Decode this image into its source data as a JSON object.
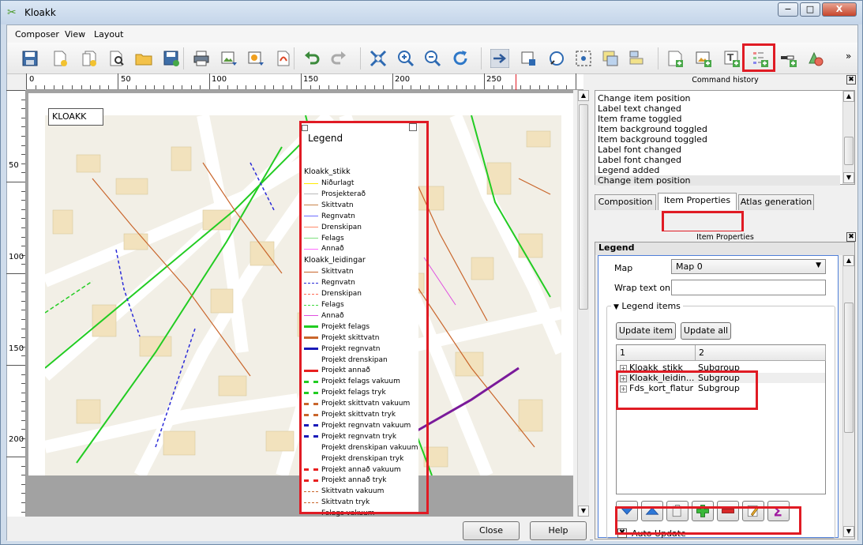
{
  "window": {
    "title": "Kloakk",
    "minimize": "−",
    "maximize": "□",
    "close": "X"
  },
  "menu": [
    "Composer",
    "View",
    "Layout"
  ],
  "toolbar": {
    "icons": [
      "save-icon",
      "new-composer-icon",
      "duplicate-composer-icon",
      "composer-manager-icon",
      "open-folder-icon",
      "save-template-icon",
      "print-icon",
      "export-image-icon",
      "export-svg-icon",
      "export-pdf-icon",
      "undo-icon",
      "redo-icon",
      "zoom-full-icon",
      "zoom-in-icon",
      "zoom-out-icon",
      "refresh-icon",
      "pan-icon",
      "move-content-icon",
      "select-icon",
      "select-group-icon",
      "raise-items-icon",
      "align-items-icon",
      "add-map-icon",
      "add-image-icon",
      "add-label-icon",
      "add-legend-icon",
      "add-scalebar-icon",
      "add-shape-icon"
    ],
    "overflow": "»"
  },
  "ruler": {
    "h_labels": [
      "0",
      "50",
      "100",
      "150",
      "200",
      "250"
    ],
    "v_labels": [
      "50",
      "100",
      "150",
      "200"
    ]
  },
  "canvas": {
    "map_label": "KLOAKK",
    "legend": {
      "title": "Legend",
      "items": [
        {
          "text": "Kloakk_stikk",
          "group": true
        },
        {
          "text": "Niðurlagt",
          "color": "#ffea00",
          "style": "solid",
          "width": 1
        },
        {
          "text": "Prosjekterað",
          "color": "#b9b9b9",
          "style": "solid",
          "width": 1
        },
        {
          "text": "Skittvatn",
          "color": "#c9834a",
          "style": "solid",
          "width": 1
        },
        {
          "text": "Regnvatn",
          "color": "#6d6dff",
          "style": "solid",
          "width": 1
        },
        {
          "text": "Drenskipan",
          "color": "#ff8a6a",
          "style": "solid",
          "width": 1
        },
        {
          "text": "Felags",
          "color": "#7ee07e",
          "style": "solid",
          "width": 1
        },
        {
          "text": "Annað",
          "color": "#ff6eff",
          "style": "solid",
          "width": 1
        },
        {
          "text": "Kloakk_leidingar",
          "group": true
        },
        {
          "text": "Skittvatn",
          "color": "#c9662c",
          "style": "solid",
          "width": 1.5
        },
        {
          "text": "Regnvatn",
          "color": "#2a2ad8",
          "style": "dashed",
          "width": 1.5
        },
        {
          "text": "Drenskipan",
          "color": "#ff6a55",
          "style": "dashed",
          "width": 1.5
        },
        {
          "text": "Felags",
          "color": "#3ed83e",
          "style": "dashed",
          "width": 1.5
        },
        {
          "text": "Annað",
          "color": "#e050e0",
          "style": "solid",
          "width": 1
        },
        {
          "text": "Projekt felags",
          "color": "#22cc22",
          "style": "solid",
          "width": 3
        },
        {
          "text": "Projekt skittvatn",
          "color": "#c9662c",
          "style": "solid",
          "width": 3
        },
        {
          "text": "Projekt regnvatn",
          "color": "#1a1ab8",
          "style": "solid",
          "width": 3
        },
        {
          "text": "Projekt drenskipan",
          "color": "#ffffff",
          "style": "solid",
          "width": 0
        },
        {
          "text": "Projekt annað",
          "color": "#e82020",
          "style": "solid",
          "width": 3
        },
        {
          "text": "Projekt felags vakuum",
          "color": "#22cc22",
          "style": "dashed",
          "width": 3
        },
        {
          "text": "Projekt felags tryk",
          "color": "#22cc22",
          "style": "dashed",
          "width": 3
        },
        {
          "text": "Projekt skittvatn vakuum",
          "color": "#c9662c",
          "style": "dashed",
          "width": 3
        },
        {
          "text": "Projekt skittvatn tryk",
          "color": "#c9662c",
          "style": "dashed",
          "width": 3
        },
        {
          "text": "Projekt regnvatn vakuum",
          "color": "#1a1ab8",
          "style": "dashed",
          "width": 3
        },
        {
          "text": "Projekt regnvatn tryk",
          "color": "#1a1ab8",
          "style": "dashed",
          "width": 3
        },
        {
          "text": "Projekt drenskipan vakuum",
          "color": "#ffffff",
          "style": "solid",
          "width": 0
        },
        {
          "text": "Projekt drenskipan tryk",
          "color": "#ffffff",
          "style": "solid",
          "width": 0
        },
        {
          "text": "Projekt annað vakuum",
          "color": "#e82020",
          "style": "dashed",
          "width": 3
        },
        {
          "text": "Projekt annað tryk",
          "color": "#e82020",
          "style": "dashed",
          "width": 3
        },
        {
          "text": "Skittvatn vakuum",
          "color": "#c9662c",
          "style": "dashed",
          "width": 1
        },
        {
          "text": "Skittvatn tryk",
          "color": "#c9662c",
          "style": "dashed",
          "width": 1
        },
        {
          "text": "Felags vakuum",
          "color": "#3ed83e",
          "style": "dashed",
          "width": 1
        }
      ]
    }
  },
  "buttons": {
    "close": "Close",
    "help": "Help"
  },
  "history": {
    "title": "Command history",
    "items": [
      "Change item position",
      "Label text changed",
      "Item frame toggled",
      "Item background toggled",
      "Item background toggled",
      "Label font changed",
      "Label font changed",
      "Legend added",
      "Change item position"
    ]
  },
  "tabs": [
    "Composition",
    "Item Properties",
    "Atlas generation"
  ],
  "item_props": {
    "title": "Item Properties",
    "section": "Legend",
    "map_label": "Map",
    "map_value": "Map 0",
    "wrap_label": "Wrap text on",
    "wrap_value": "",
    "legend_items_label": "Legend items",
    "update_item": "Update item",
    "update_all": "Update all",
    "tree_headers": [
      "1",
      "2"
    ],
    "tree_rows": [
      {
        "name": "Kloakk_stikk",
        "type": "Subgroup"
      },
      {
        "name": "Kloakk_leidin...",
        "type": "Subgroup"
      },
      {
        "name": "Fds_kort_flatur",
        "type": "Subgroup"
      }
    ],
    "action_icons": [
      "move-down-icon",
      "move-up-icon",
      "add-group-icon",
      "add-item-icon",
      "remove-item-icon",
      "edit-item-icon",
      "count-icon"
    ],
    "auto_update_label": "Auto Update",
    "auto_update_checked": "✖"
  },
  "colors": {
    "highlight": "#e01b24",
    "map_base": "#f2efe6",
    "building": "#f2e2bd"
  }
}
